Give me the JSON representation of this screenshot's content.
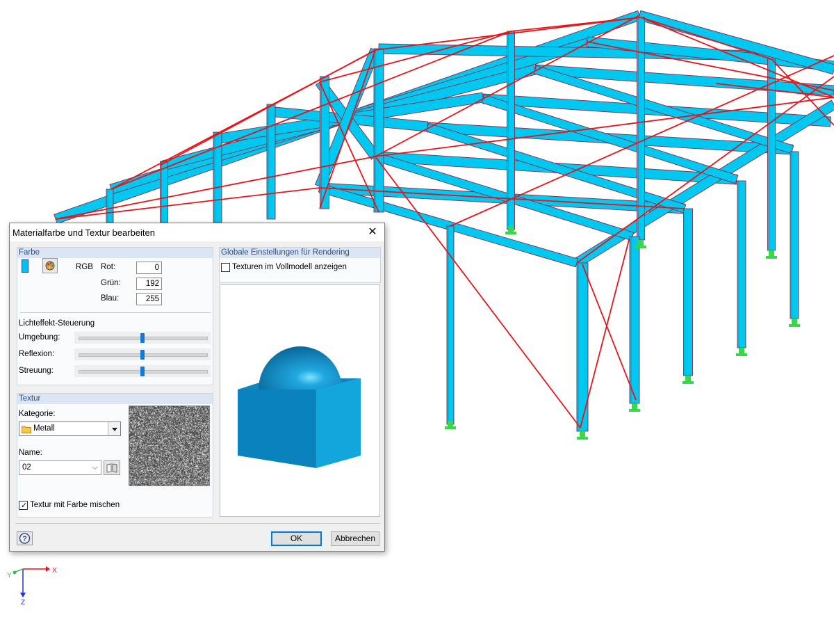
{
  "dialog": {
    "title": "Materialfarbe und Textur bearbeiten",
    "color_group": {
      "header": "Farbe",
      "swatch_color": "#00C0FF",
      "rgb_label": "RGB",
      "red_label": "Rot:",
      "red_value": "0",
      "green_label": "Grün:",
      "green_value": "192",
      "blue_label": "Blau:",
      "blue_value": "255",
      "lighting_heading": "Lichteffekt-Steuerung",
      "sliders": [
        {
          "label": "Umgebung:",
          "level": 0.5
        },
        {
          "label": "Reflexion:",
          "level": 0.5
        },
        {
          "label": "Streuung:",
          "level": 0.5
        }
      ]
    },
    "texture_group": {
      "header": "Textur",
      "category_label": "Kategorie:",
      "category_value": "Metall",
      "name_label": "Name:",
      "name_value": "02",
      "mix_checkbox_label": "Textur mit Farbe mischen",
      "mix_checked": true
    },
    "render_group": {
      "header": "Globale Einstellungen für Rendering",
      "show_textures_label": "Texturen im Vollmodell anzeigen",
      "show_textures_checked": false
    },
    "ok_label": "OK",
    "cancel_label": "Abbrechen"
  },
  "axes": {
    "x": "X",
    "y": "Y",
    "z": "Z"
  },
  "colors": {
    "beam": "#00C8F0",
    "bracing": "#E8141A",
    "support": "#39D84A",
    "accent": "#0078D7"
  }
}
